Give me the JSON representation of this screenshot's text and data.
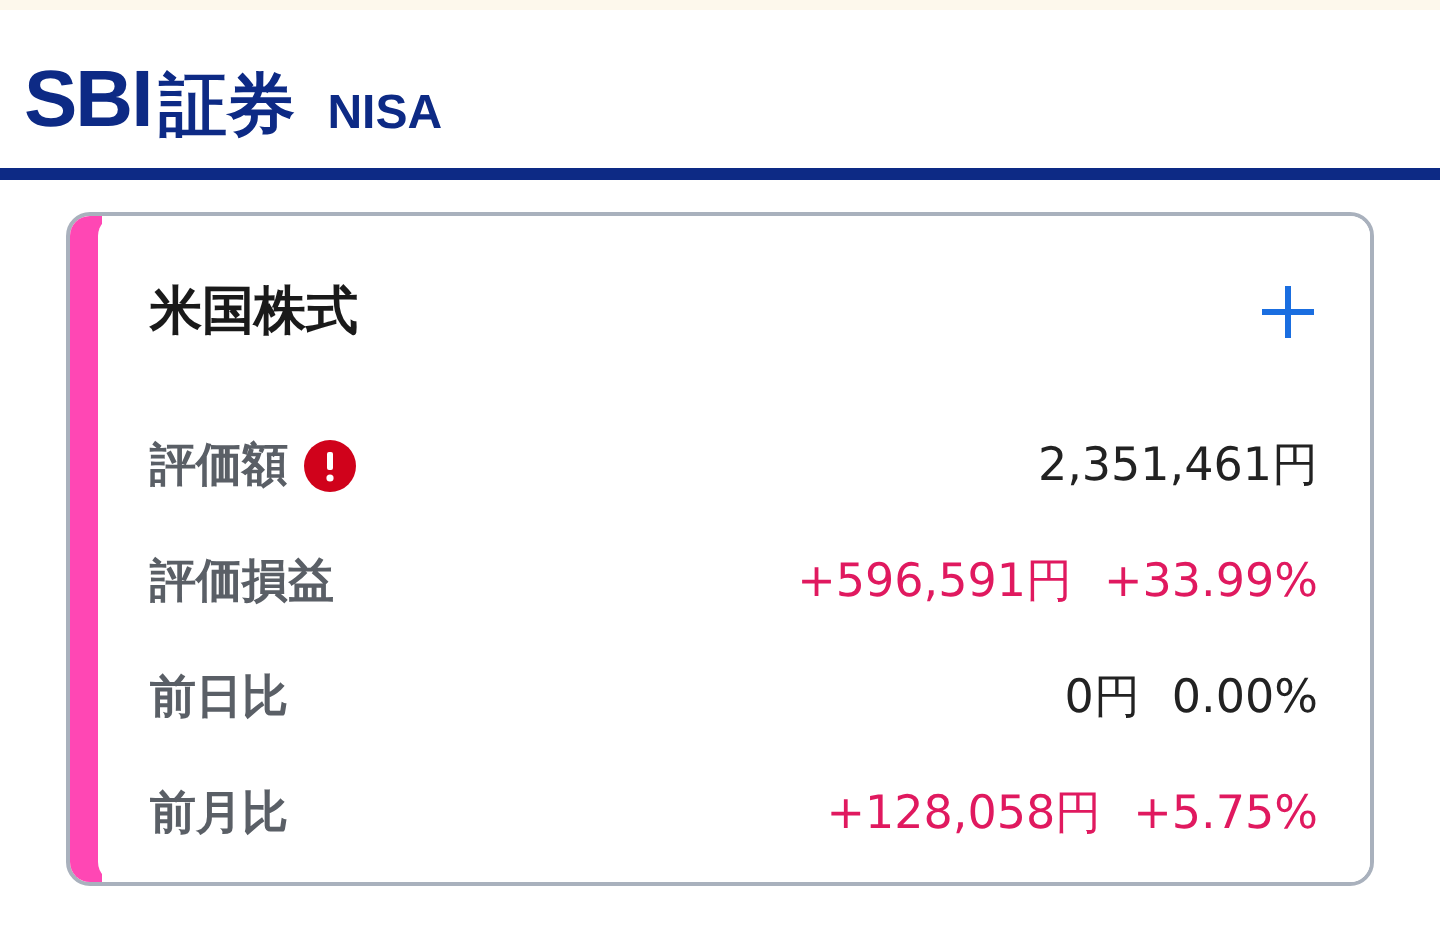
{
  "header": {
    "logo": "SBI",
    "logo_suffix": "証券",
    "badge": "NISA"
  },
  "card": {
    "title": "米国株式",
    "rows": [
      {
        "label": "評価額",
        "warning": true,
        "color": "#222222",
        "values": [
          "2,351,461円"
        ]
      },
      {
        "label": "評価損益",
        "warning": false,
        "color": "#e0195f",
        "values": [
          "+596,591円",
          "+33.99%"
        ]
      },
      {
        "label": "前日比",
        "warning": false,
        "color": "#222222",
        "values": [
          "0円",
          "0.00%"
        ]
      },
      {
        "label": "前月比",
        "warning": false,
        "color": "#e0195f",
        "values": [
          "+128,058円",
          "+5.75%"
        ]
      }
    ]
  }
}
